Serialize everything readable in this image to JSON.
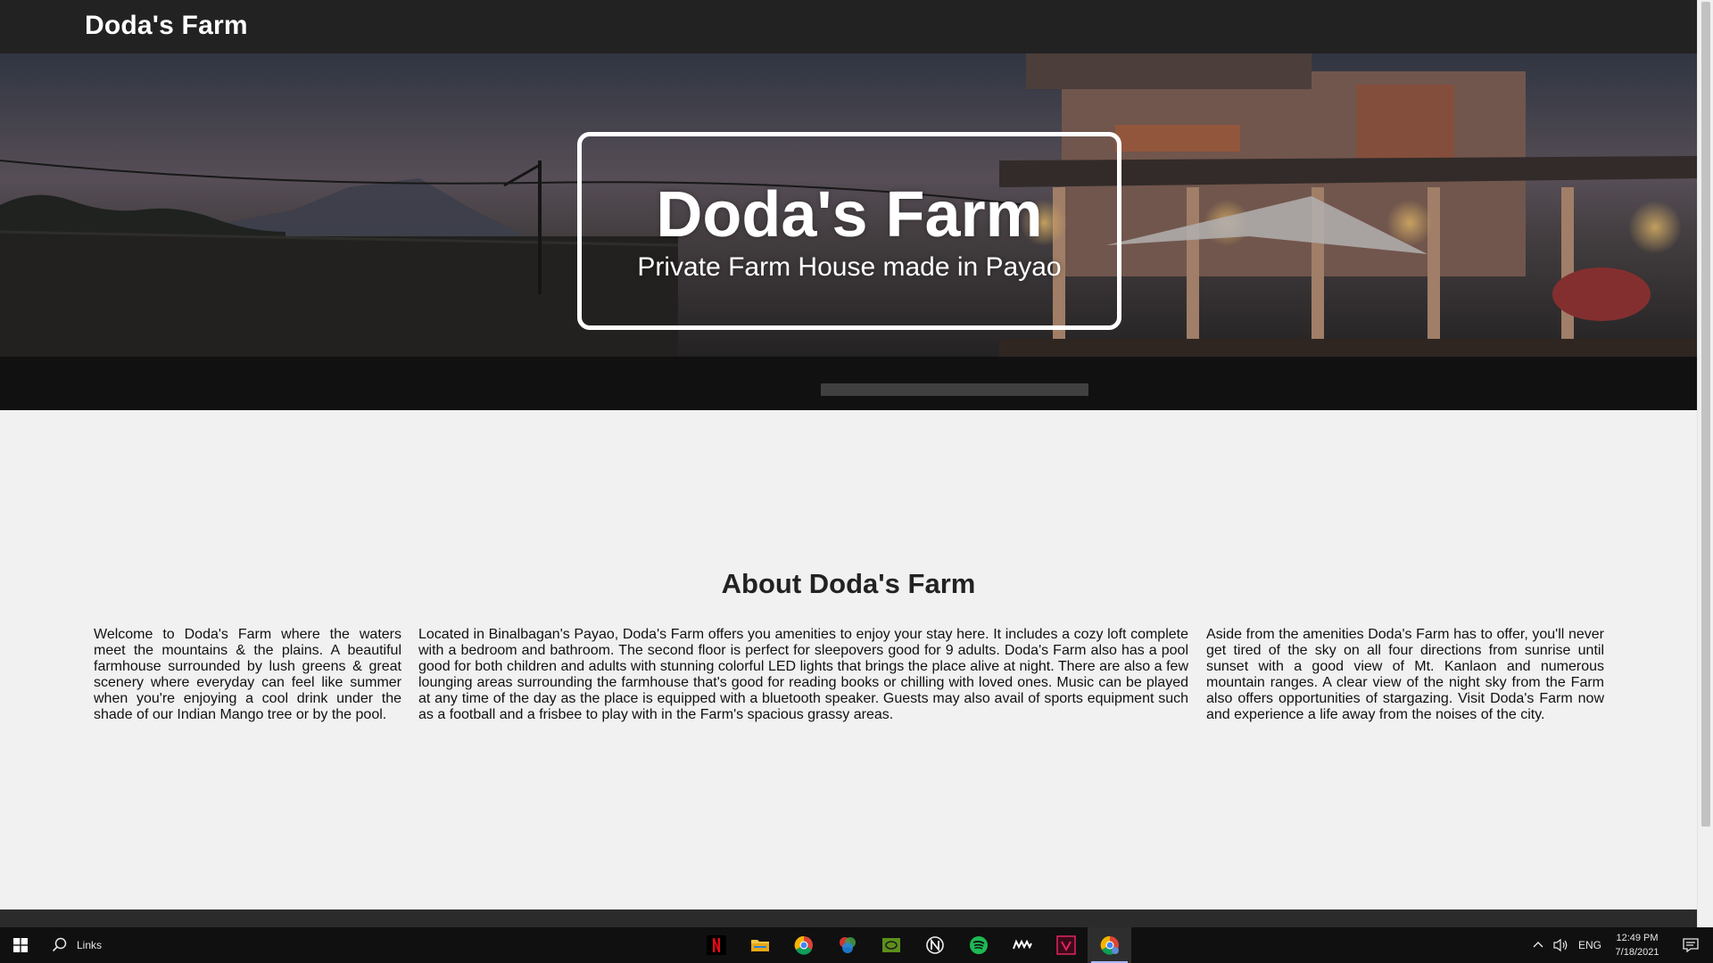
{
  "nav": {
    "brand": "Doda's Farm"
  },
  "hero": {
    "title": "Doda's Farm",
    "subtitle": "Private Farm House made in Payao"
  },
  "about": {
    "title": "About Doda's Farm",
    "columns": [
      "Welcome to Doda's Farm where the waters meet the mountains & the plains. A beautiful farmhouse surrounded by lush greens & great scenery where everyday can feel like summer when you're enjoying a cool drink under the shade of our Indian Mango tree or by the pool.",
      "Located in Binalbagan's Payao, Doda's Farm offers you amenities to enjoy your stay here. It includes a cozy loft complete with a bedroom and bathroom. The second floor is perfect for sleepovers good for 9 adults. Doda's Farm also has a pool good for both children and adults with stunning colorful LED lights that brings the place alive at night. There are also a few lounging areas surrounding the farmhouse that's good for reading books or chilling with loved ones. Music can be played at any time of the day as the place is equipped with a bluetooth speaker. Guests may also avail of sports equipment such as a football and a frisbee to play with in the Farm's spacious grassy areas.",
      "Aside from the amenities Doda's Farm has to offer, you'll never get tired of the sky on all four directions from sunrise until sunset with a good view of Mt. Kanlaon and numerous mountain ranges. A clear view of the night sky from the Farm also offers opportunities of stargazing. Visit Doda's Farm now and experience a life away from the noises of the city."
    ]
  },
  "taskbar": {
    "search_label": "Links",
    "apps": [
      "netflix-icon",
      "file-explorer-icon",
      "chrome-icon",
      "color-app-icon",
      "nvidia-icon",
      "app-n-icon",
      "spotify-icon",
      "mw-app-icon",
      "v-app-icon",
      "chrome-profile-icon"
    ],
    "language": "ENG",
    "time": "12:49 PM",
    "date": "7/18/2021"
  },
  "colors": {
    "navbar": "#222222",
    "page_bg": "#f1f1f1",
    "taskbar": "#101010"
  }
}
